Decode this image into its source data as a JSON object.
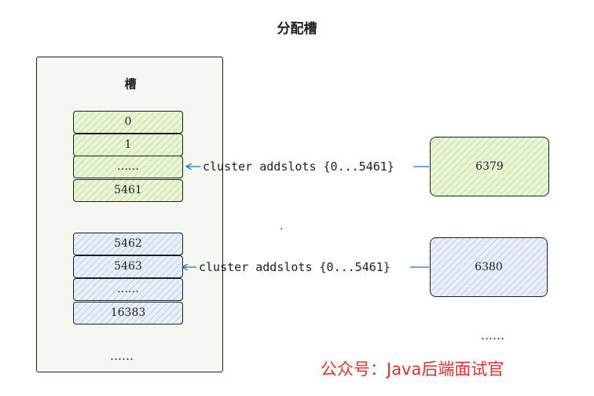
{
  "title": "分配槽",
  "panel": {
    "label": "槽",
    "bottom_ellipsis": "……"
  },
  "groups": [
    {
      "color": "#9dc94d",
      "slots": [
        "0",
        "1",
        "……",
        "5461"
      ],
      "command": "cluster addslots {0...5461}",
      "node": "6379"
    },
    {
      "color": "#8aa8d6",
      "slots": [
        "5462",
        "5463",
        "……",
        "16383"
      ],
      "command": "cluster addslots {0...5461}",
      "node": "6380"
    }
  ],
  "nodes_ellipsis": "……",
  "watermark": "公众号：Java后端面试官",
  "colors": {
    "arrow": "#1971c2",
    "watermark": "#e0312b"
  }
}
